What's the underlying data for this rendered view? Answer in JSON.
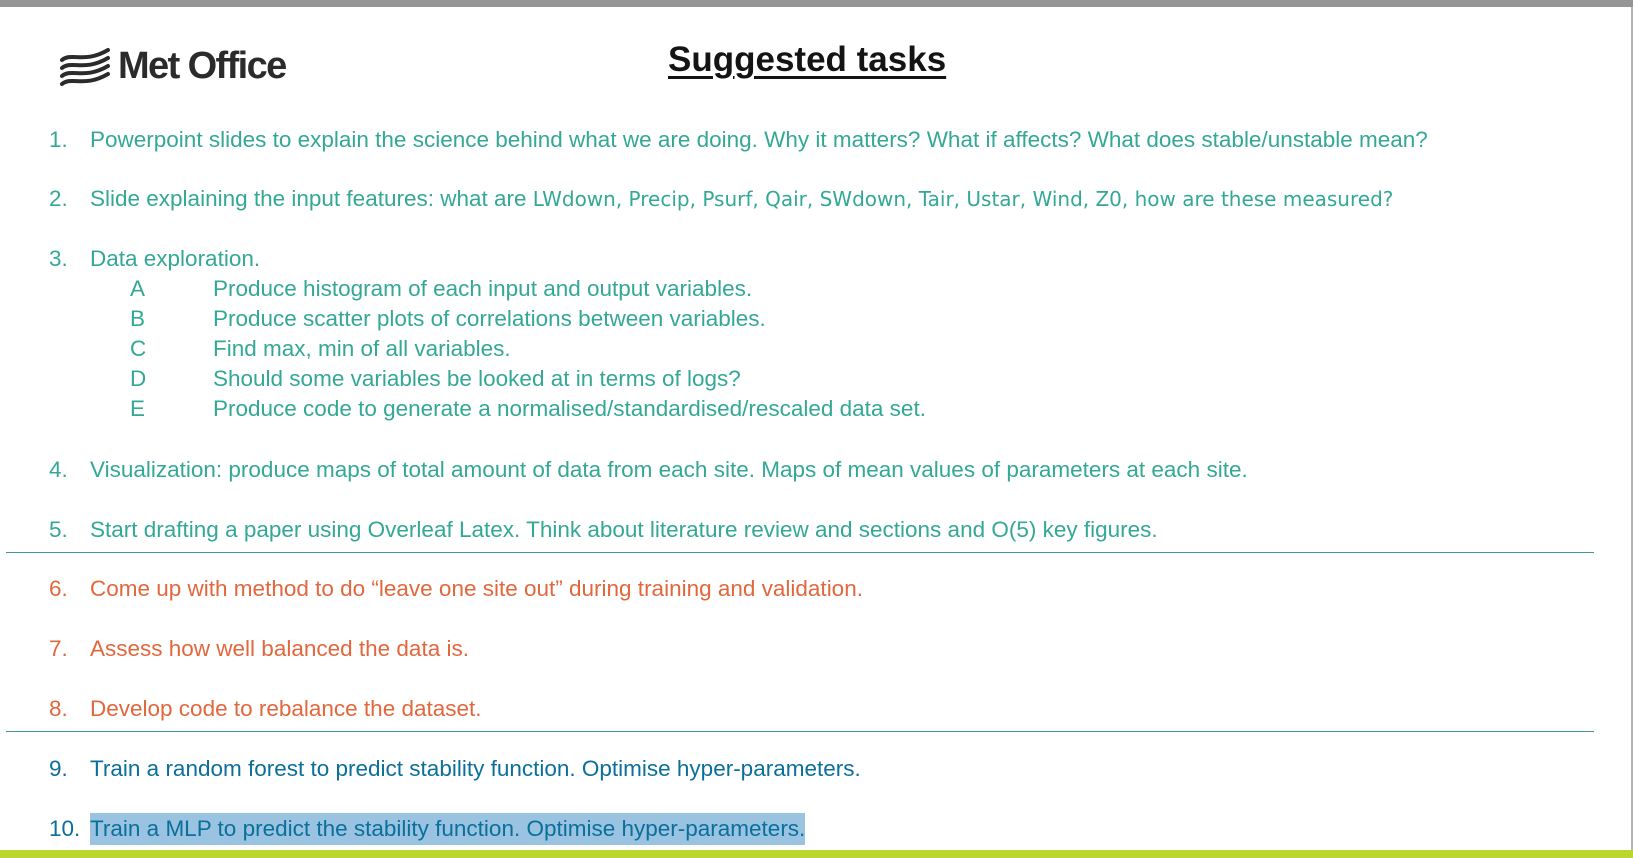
{
  "logo": {
    "text": "Met Office",
    "icon": "met-office-waves-icon"
  },
  "title": "Suggested tasks",
  "colors": {
    "teal": "#34a896",
    "orange": "#e2673d",
    "blue": "#0b6f9c",
    "highlight": "#99c3e0",
    "bottom_bar": "#bcd630"
  },
  "tasks": [
    {
      "num": "1.",
      "text": "Powerpoint slides to explain the science behind what we are doing. Why it matters? What if affects? What does stable/unstable mean?"
    },
    {
      "num": "2.",
      "text": "Slide explaining the input features: what are ",
      "text2": "LWdown, Precip, Psurf, Qair, SWdown, Tair, Ustar, Wind, Z0, how are these measured?"
    },
    {
      "num": "3.",
      "text": "Data exploration.",
      "subtasks": [
        {
          "letter": "A",
          "text": "Produce histogram of each input and output variables."
        },
        {
          "letter": "B",
          "text": "Produce scatter plots of correlations between variables."
        },
        {
          "letter": "C",
          "text": "Find max, min of all variables."
        },
        {
          "letter": "D",
          "text": "Should some variables be looked at in terms of logs?"
        },
        {
          "letter": "E",
          "text": "Produce code to generate a normalised/standardised/rescaled data set."
        }
      ]
    },
    {
      "num": "4.",
      "text": "Visualization: produce maps of total amount of data from each site. Maps of mean values of parameters at each site."
    },
    {
      "num": "5.",
      "text": "Start drafting a paper using Overleaf Latex. Think about literature review and sections and O(5) key figures."
    },
    {
      "num": "6.",
      "text": "Come up with method to do “leave one site out” during training and validation."
    },
    {
      "num": "7.",
      "text": "Assess how well balanced the data is."
    },
    {
      "num": "8.",
      "text": "Develop code to rebalance the dataset."
    },
    {
      "num": "9.",
      "text": "Train a random forest to predict stability function. Optimise hyper-parameters."
    },
    {
      "num": "10.",
      "text": "Train a MLP to predict the stability function. Optimise hyper-parameters."
    }
  ]
}
